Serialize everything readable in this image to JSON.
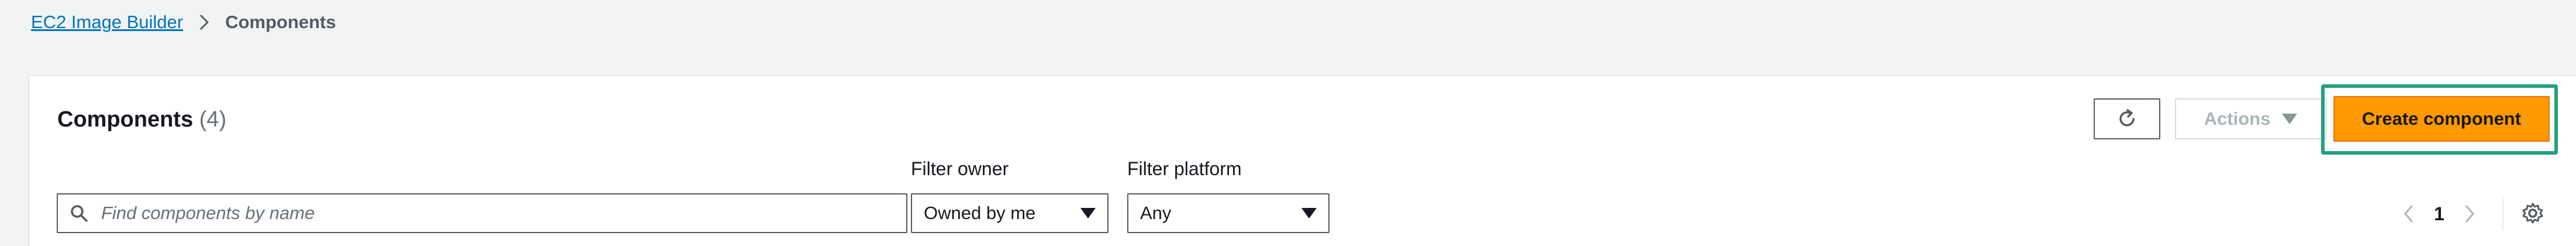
{
  "breadcrumb": {
    "parent": "EC2 Image Builder",
    "current": "Components"
  },
  "panel": {
    "title": "Components",
    "count": "(4)"
  },
  "toolbar": {
    "refresh_icon": "refresh-icon",
    "actions_label": "Actions",
    "create_label": "Create component",
    "primary_color": "#ff9900",
    "highlight_color": "#22a07e"
  },
  "filters": {
    "search_placeholder": "Find components by name",
    "search_value": "",
    "owner_label": "Filter owner",
    "owner_value": "Owned by me",
    "platform_label": "Filter platform",
    "platform_value": "Any"
  },
  "pagination": {
    "current_page": "1"
  },
  "colors": {
    "link": "#0073bb",
    "background": "#f2f3f3"
  }
}
